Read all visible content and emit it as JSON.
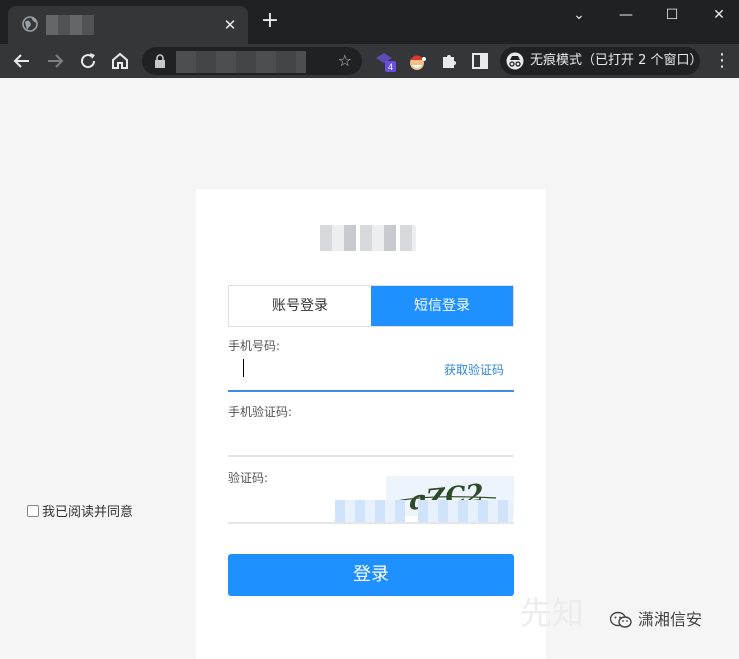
{
  "browser": {
    "close_tab": "✕",
    "new_tab": "+",
    "incognito_label": "无痕模式（已打开 2 个窗口）",
    "ext_badge": "4",
    "window": {
      "minimize": "—",
      "maximize": "☐",
      "close": "✕",
      "chevron": "⌄"
    },
    "menu": "⋮"
  },
  "login": {
    "tabs": [
      {
        "label": "账号登录",
        "active": false
      },
      {
        "label": "短信登录",
        "active": true
      }
    ],
    "phone_label": "手机号码:",
    "get_code": "获取验证码",
    "sms_label": "手机验证码:",
    "captcha_label": "验证码:",
    "captcha_text": "qZC2",
    "submit": "登录",
    "agree": "我已阅读并同意"
  },
  "watermark": {
    "account": "潇湘信安",
    "ghost": "先知"
  },
  "colors": {
    "accent": "#1e90ff",
    "link": "#2f86de",
    "chrome_bg": "#202124"
  }
}
